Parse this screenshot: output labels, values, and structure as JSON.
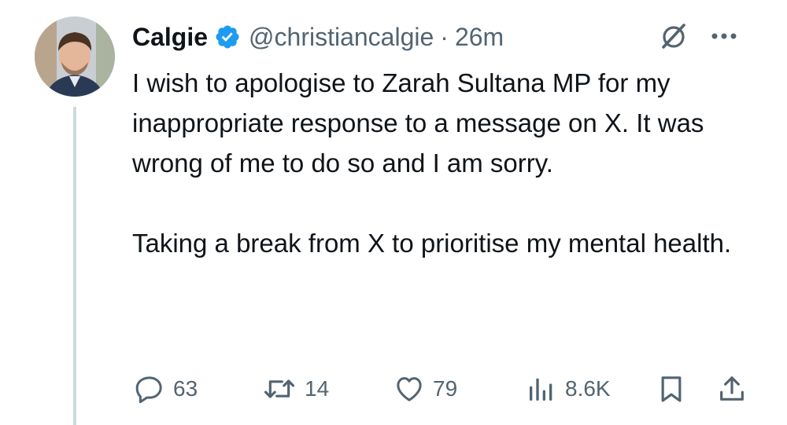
{
  "tweet": {
    "display_name": "Calgie",
    "handle": "@christiancalgie",
    "separator": "·",
    "time": "26m",
    "text": "I wish to apologise to Zarah Sultana MP for my inappropriate response to a message on X. It was wrong of me to do so and I am sorry.\n\nTaking a break from X to prioritise my mental health."
  },
  "actions": {
    "replies": "63",
    "reposts": "14",
    "likes": "79",
    "views": "8.6K"
  },
  "colors": {
    "text": "#0f1419",
    "secondary": "#536471",
    "verified_blue": "#1d9bf0",
    "thread_line": "#cfd9de"
  }
}
